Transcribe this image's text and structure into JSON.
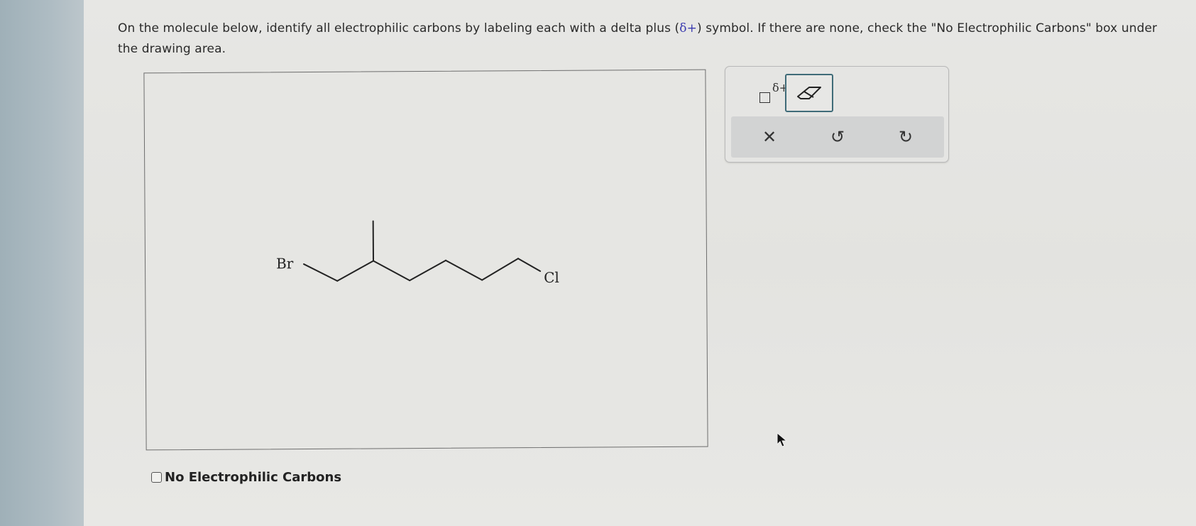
{
  "question": {
    "part1": "On the molecule below, identify all electrophilic carbons by labeling each with a delta plus (",
    "delta_symbol": "δ+",
    "part2": ") symbol. If there are none, check the \"No Electrophilic Carbons\" box under the drawing area."
  },
  "molecule": {
    "left_atom": "Br",
    "right_atom": "Cl"
  },
  "checkbox": {
    "label": "No Electrophilic Carbons",
    "checked": false
  },
  "toolbar": {
    "delta_tool_label": "δ+",
    "eraser_icon": "eraser-icon",
    "clear_symbol": "✕",
    "undo_symbol": "↺",
    "redo_symbol": "↻"
  },
  "colors": {
    "delta_text": "#3a3ab0",
    "eraser_border": "#3f6b78"
  }
}
